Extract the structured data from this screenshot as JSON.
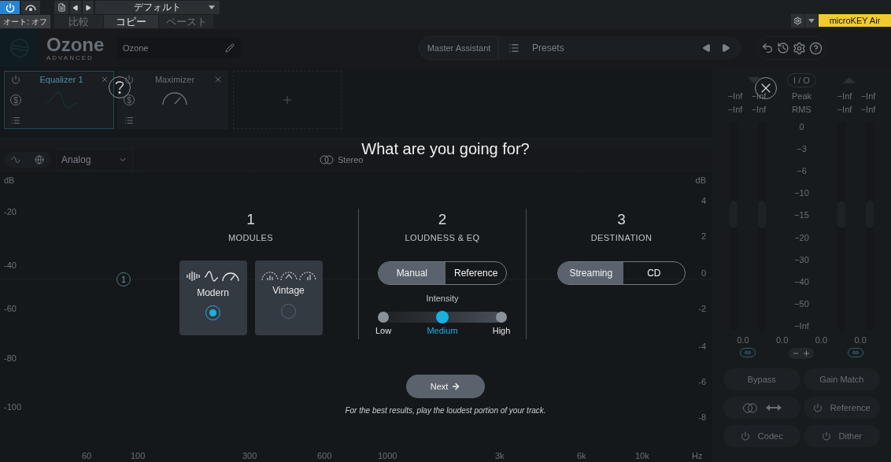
{
  "host": {
    "power_on": true,
    "auto_label": "オート: オフ",
    "preset": "デフォルト",
    "actions": [
      {
        "label": "比較",
        "disabled": true
      },
      {
        "label": "コピー",
        "disabled": false
      },
      {
        "label": "ペースト",
        "disabled": true
      }
    ],
    "device": "microKEY Air"
  },
  "header": {
    "logo": "Ozone",
    "edition": "ADVANCED",
    "preset_name": "Ozone",
    "assistant": "Master Assistant",
    "presets": "Presets"
  },
  "modules": [
    {
      "name": "Equalizer 1",
      "kind": "eq",
      "selected": true,
      "solo_symbol": "$"
    },
    {
      "name": "Maximizer",
      "kind": "maximizer",
      "selected": false,
      "solo_symbol": "$"
    }
  ],
  "eq_toolbar": {
    "mode": "Analog",
    "stereo": "Stereo"
  },
  "graph": {
    "left_axis": [
      "dB",
      "-20",
      "-40",
      "-60",
      "-80",
      "-100"
    ],
    "right_axis": [
      "dB",
      "4",
      "2",
      "0",
      "-2",
      "-4",
      "-6",
      "-8"
    ],
    "freq_axis": [
      "60",
      "100",
      "300",
      "600",
      "1000",
      "3k",
      "6k",
      "10k",
      "Hz"
    ],
    "nodes": [
      "1"
    ]
  },
  "meters": {
    "title": "I / O",
    "input_peak": [
      "−Inf",
      "−Inf"
    ],
    "input_rms": [
      "−Inf",
      "−Inf"
    ],
    "peak_label": "Peak",
    "rms_label": "RMS",
    "output_peak": [
      "−Inf",
      "−Inf"
    ],
    "output_rms": [
      "−Inf",
      "−Inf"
    ],
    "scale": [
      "0",
      "−3",
      "−6",
      "−10",
      "−15",
      "−20",
      "−30",
      "−40",
      "−50",
      "−Inf"
    ],
    "gains": [
      "0.0",
      "0.0",
      "0.0",
      "0.0"
    ],
    "buttons": [
      "Bypass",
      "Gain Match"
    ],
    "reference": "Reference",
    "codec": "Codec",
    "dither": "Dither"
  },
  "wizard": {
    "title": "What are you going for?",
    "steps": [
      {
        "number": "1",
        "label": "MODULES"
      },
      {
        "number": "2",
        "label": "LOUDNESS & EQ"
      },
      {
        "number": "3",
        "label": "DESTINATION"
      }
    ],
    "module_options": [
      {
        "name": "Modern",
        "kind": "modern",
        "selected": true
      },
      {
        "name": "Vintage",
        "kind": "vintage",
        "selected": false
      }
    ],
    "loudness_modes": [
      {
        "label": "Manual",
        "selected": true
      },
      {
        "label": "Reference",
        "selected": false
      }
    ],
    "intensity": {
      "label": "Intensity",
      "stops": [
        {
          "label": "Low",
          "selected": false
        },
        {
          "label": "Medium",
          "selected": true
        },
        {
          "label": "High",
          "selected": false
        }
      ]
    },
    "destinations": [
      {
        "label": "Streaming",
        "selected": true
      },
      {
        "label": "CD",
        "selected": false
      }
    ],
    "next": "Next",
    "note": "For the best results, play the loudest portion of your track."
  }
}
